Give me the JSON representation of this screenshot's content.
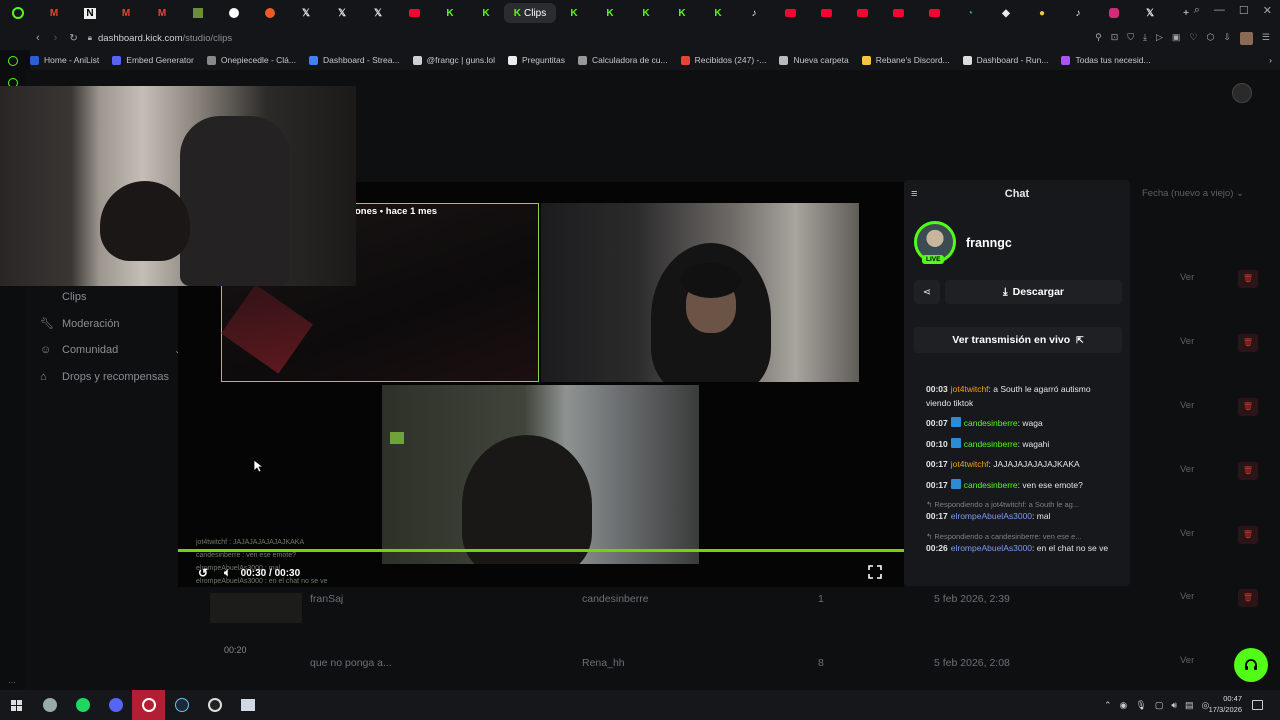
{
  "browser": {
    "active_tab_label": "Clips",
    "url_host": "dashboard.kick.com",
    "url_path": "/studio/clips",
    "bookmarks": [
      {
        "label": "Home - AniList",
        "color": "#2b5fd8"
      },
      {
        "label": "Embed Generator",
        "color": "#5865f2"
      },
      {
        "label": "Onepiecedle - Clá...",
        "color": "#888888"
      },
      {
        "label": "Dashboard - Strea...",
        "color": "#3b82f6"
      },
      {
        "label": "@frangc | guns.lol",
        "color": "#d0d0d0"
      },
      {
        "label": "Preguntitas",
        "color": "#eeeeee"
      },
      {
        "label": "Calculadora de cu...",
        "color": "#999999"
      },
      {
        "label": "Recibidos (247) -...",
        "color": "#ea4335"
      },
      {
        "label": "Nueva carpeta",
        "color": "#bbbbbb"
      },
      {
        "label": "Rebane's Discord...",
        "color": "#f5c542"
      },
      {
        "label": "Dashboard - Run...",
        "color": "#dddddd"
      },
      {
        "label": "Todas tus necesid...",
        "color": "#a855f7"
      }
    ]
  },
  "sidebar": {
    "items": [
      {
        "label": "Clips",
        "icon": "clip-icon"
      },
      {
        "label": "Moderación",
        "icon": "wrench-icon"
      },
      {
        "label": "Comunidad",
        "icon": "people-icon"
      },
      {
        "label": "Drops y recompensas",
        "icon": "gift-icon"
      }
    ]
  },
  "player": {
    "clip_meta": "ones • hace 1 mes",
    "time": "00:30 / 00:30",
    "progress": 1.0,
    "overlay_chat": [
      "jot4twitchf : JAJAJAJAJAJAJKAKA",
      "candesinberre : ven ese emote?",
      "elrompeAbuelAs3000 : mal",
      "elrompeAbuelAs3000 : en el chat no se ve"
    ]
  },
  "chat": {
    "title": "Chat",
    "streamer": "franngc",
    "live_badge": "LIVE",
    "download_label": "Descargar",
    "watch_label": "Ver transmisión en vivo",
    "messages": [
      {
        "time": "00:03",
        "user": "jot4twitchf",
        "color": "#f0a020",
        "badge": false,
        "text": "a South le agarró autismo viendo tiktok",
        "reply": ""
      },
      {
        "time": "00:07",
        "user": "candesinberre",
        "color": "#53fc18",
        "badge": true,
        "text": "waga",
        "reply": ""
      },
      {
        "time": "00:10",
        "user": "candesinberre",
        "color": "#53fc18",
        "badge": true,
        "text": "wagahi",
        "reply": ""
      },
      {
        "time": "00:17",
        "user": "jot4twitchf",
        "color": "#f0a020",
        "badge": false,
        "text": "JAJAJAJAJAJAJKAKA",
        "reply": ""
      },
      {
        "time": "00:17",
        "user": "candesinberre",
        "color": "#53fc18",
        "badge": true,
        "text": "ven ese emote?",
        "reply": ""
      },
      {
        "time": "00:17",
        "user": "elrompeAbuelAs3000",
        "color": "#7b9cf5",
        "badge": false,
        "text": "mal",
        "reply": "Respondiendo a jot4twitchf: a South le ag..."
      },
      {
        "time": "00:26",
        "user": "elrompeAbuelAs3000",
        "color": "#7b9cf5",
        "badge": false,
        "text": "en el chat no se ve",
        "reply": "Respondiendo a candesinberre: ven ese e..."
      }
    ]
  },
  "clips_table": {
    "filter_label": "Fecha (nuevo a viejo)",
    "row_action": "Ver",
    "rows": [
      {
        "duration": "",
        "title": "franSaj",
        "author": "candesinberre",
        "views": "1",
        "date": "5 feb 2026, 2:39"
      },
      {
        "duration": "00:20",
        "title": "que no ponga a...",
        "author": "Rena_hh",
        "views": "8",
        "date": "5 feb 2026, 2:08"
      }
    ]
  },
  "taskbar": {
    "time": "00:47",
    "date": "17/3/2026"
  }
}
